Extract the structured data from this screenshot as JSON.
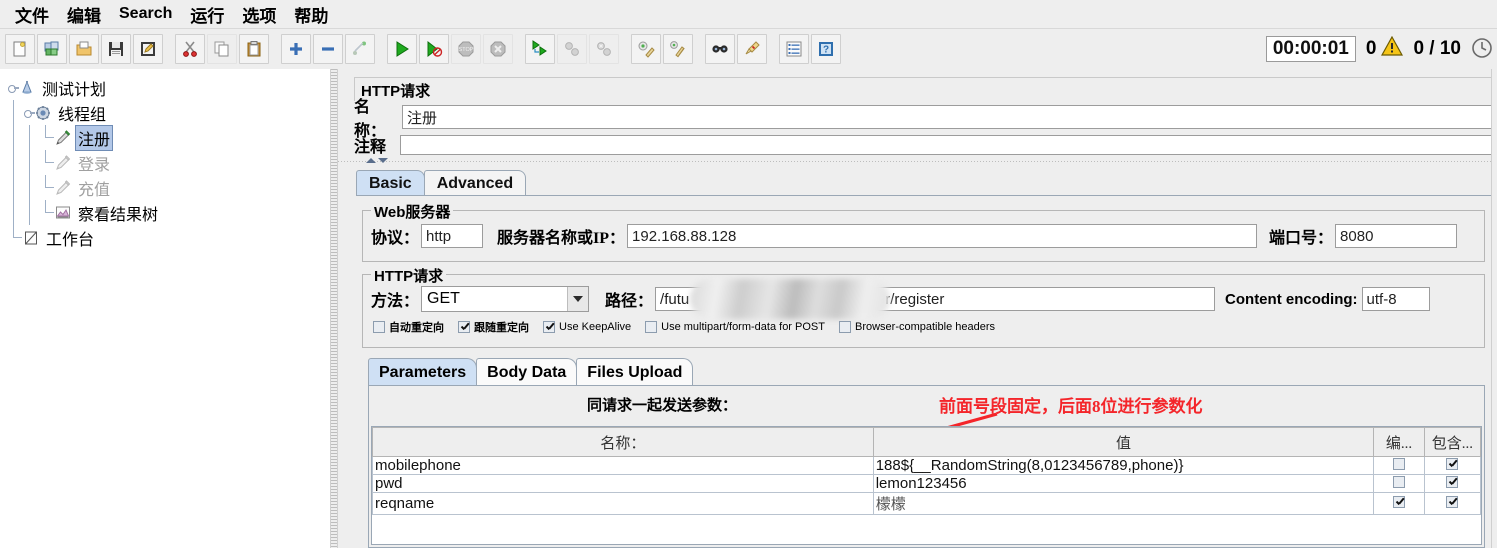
{
  "menu": {
    "items": [
      {
        "label": "文件",
        "script": "cjk"
      },
      {
        "label": "编辑",
        "script": "cjk"
      },
      {
        "label": "Search",
        "script": "latin"
      },
      {
        "label": "运行",
        "script": "cjk"
      },
      {
        "label": "选项",
        "script": "cjk"
      },
      {
        "label": "帮助",
        "script": "cjk"
      }
    ]
  },
  "toolbar": {
    "buttons": [
      "new-icon",
      "templates-icon",
      "open-icon",
      "save-icon",
      "save-as-icon",
      "cut-icon",
      "copy-icon",
      "paste-icon",
      "expand-icon",
      "collapse-icon",
      "toggle-icon",
      "start-icon",
      "start-no-pauses-icon",
      "stop-icon",
      "shutdown-icon",
      "remote-start-all-icon",
      "remote-stop-all-icon",
      "remote-shutdown-all-icon",
      "clear-icon",
      "clear-all-icon",
      "search-icon",
      "reset-search-icon",
      "function-helper-icon",
      "help-icon"
    ],
    "status": {
      "elapsed_time": "00:00:01",
      "warning_count": "0",
      "warning_icon": "warning-triangle-icon",
      "threads": "0 / 10",
      "clock_icon": "clock-icon"
    }
  },
  "tree": {
    "nodes": [
      {
        "label": "测试计划",
        "icon": "test-plan-icon",
        "state": "normal",
        "depth": 0
      },
      {
        "label": "线程组",
        "icon": "thread-group-icon",
        "state": "normal",
        "depth": 1
      },
      {
        "label": "注册",
        "icon": "http-sampler-icon",
        "state": "selected",
        "depth": 2
      },
      {
        "label": "登录",
        "icon": "http-sampler-disabled-icon",
        "state": "disabled",
        "depth": 2
      },
      {
        "label": "充值",
        "icon": "http-sampler-disabled-icon",
        "state": "disabled",
        "depth": 2
      },
      {
        "label": "察看结果树",
        "icon": "view-results-tree-icon",
        "state": "normal",
        "depth": 2
      },
      {
        "label": "工作台",
        "icon": "workbench-icon",
        "state": "normal",
        "depth": 0
      }
    ]
  },
  "panel": {
    "title": "HTTP请求",
    "name_label": "名称：",
    "name_value": "注册",
    "comment_label": "注释",
    "comment_value": "",
    "tabs": [
      {
        "label": "Basic",
        "active": true
      },
      {
        "label": "Advanced",
        "active": false
      }
    ],
    "web_server": {
      "group_title": "Web服务器",
      "protocol_label": "协议：",
      "protocol_value": "http",
      "server_label": "服务器名称或IP：",
      "server_value": "192.168.88.128",
      "port_label": "端口号：",
      "port_value": "8080"
    },
    "http_request": {
      "group_title": "HTTP请求",
      "method_label": "方法：",
      "method_value": "GET",
      "path_label": "路径：",
      "path_prefix": "/futu",
      "path_suffix": "r/register",
      "content_encoding_label": "Content encoding:",
      "content_encoding_value": "utf-8",
      "checkboxes": [
        {
          "label": "自动重定向",
          "checked": false,
          "script": "cjk"
        },
        {
          "label": "跟随重定向",
          "checked": true,
          "script": "cjk"
        },
        {
          "label": "Use KeepAlive",
          "checked": true,
          "script": "latin"
        },
        {
          "label": "Use multipart/form-data for POST",
          "checked": false,
          "script": "latin"
        },
        {
          "label": "Browser-compatible headers",
          "checked": false,
          "script": "latin"
        }
      ]
    },
    "param_tabs": [
      {
        "label": "Parameters",
        "active": true
      },
      {
        "label": "Body Data",
        "active": false
      },
      {
        "label": "Files Upload",
        "active": false
      }
    ],
    "params": {
      "send_with_request_label": "同请求一起发送参数：",
      "annotation": "前面号段固定，后面8位进行参数化",
      "columns": [
        "名称：",
        "值",
        "编...",
        "包含..."
      ],
      "rows": [
        {
          "name": "mobilephone",
          "value": "188${__RandomString(8,0123456789,phone)}",
          "encode": false,
          "include": true,
          "cjk_value": false
        },
        {
          "name": "pwd",
          "value": "lemon123456",
          "encode": false,
          "include": true,
          "cjk_value": false
        },
        {
          "name": "reqname",
          "value": "檬檬",
          "encode": true,
          "include": true,
          "cjk_value": true
        }
      ]
    }
  },
  "colors": {
    "accent": "#cfe0f4",
    "selection": "#b3c8e8",
    "annotation": "#f4252a",
    "panel_bg": "#eeeeee",
    "warning": "#f5c518"
  }
}
